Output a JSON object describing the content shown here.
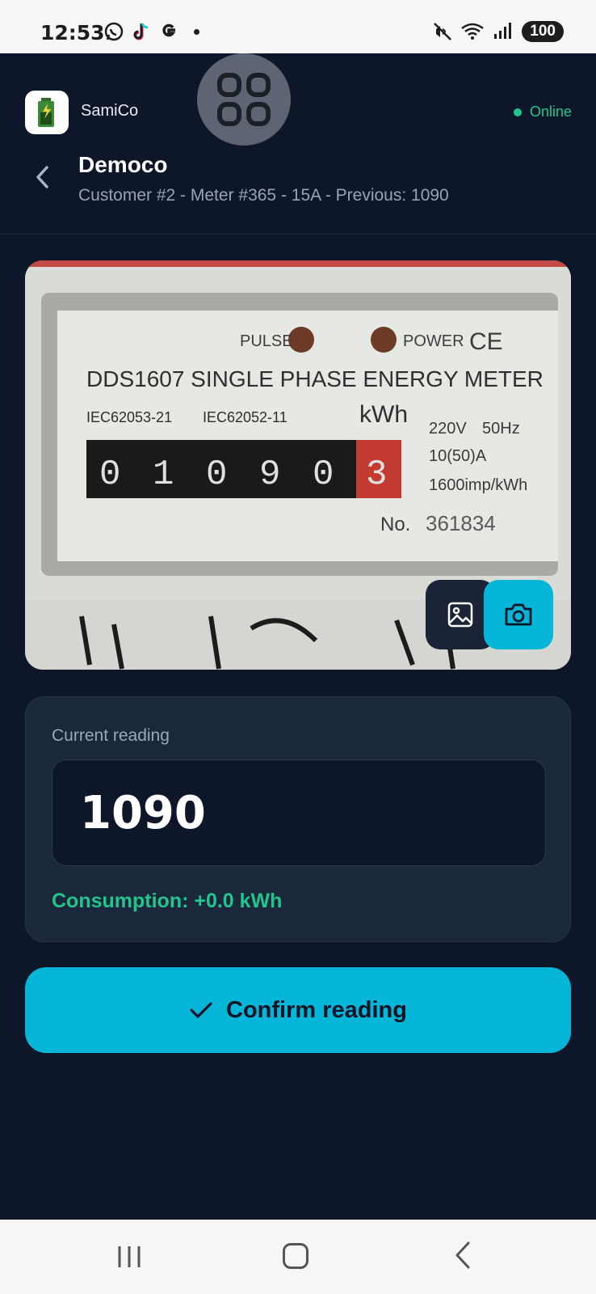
{
  "status_bar": {
    "time": "12:53",
    "battery": "100",
    "icons": [
      "whatsapp-icon",
      "tiktok-icon",
      "google-icon",
      "dot-icon",
      "mute-icon",
      "wifi-icon",
      "signal-icon"
    ]
  },
  "header": {
    "app_name": "SamiCo",
    "status": "Online",
    "title": "Democo",
    "subtitle": "Customer #2 - Meter #365 - 15A - Previous: 1090"
  },
  "photo": {
    "meter_model": "DDS1607 SINGLE PHASE ENERGY METER",
    "pulse_label": "PULSE",
    "power_label": "POWER",
    "standard1": "IEC62053-21",
    "standard2": "IEC62052-11",
    "unit": "kWh",
    "digits": [
      "0",
      "1",
      "0",
      "9",
      "0",
      "3"
    ],
    "spec_voltage": "220V",
    "spec_freq": "50Hz",
    "spec_current": "10(50)A",
    "spec_imp": "1600imp/kWh",
    "no_label": "No.",
    "serial": "361834",
    "ce_mark": "CE"
  },
  "reading": {
    "label": "Current reading",
    "value": "1090",
    "consumption": "Consumption: +0.0 kWh"
  },
  "confirm_label": "Confirm reading",
  "colors": {
    "background": "#0e1729",
    "card": "#1b273a",
    "accent": "#06b6d9",
    "success": "#22c58b"
  }
}
